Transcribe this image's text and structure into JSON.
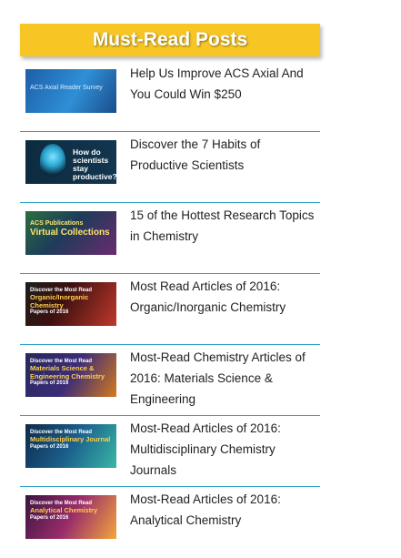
{
  "header": {
    "title": "Must-Read Posts"
  },
  "thumbnails": [
    {
      "l1": "ACS Axial Reader Survey",
      "l2": "",
      "l3": ""
    },
    {
      "l1": "How do scientists stay productive?",
      "l2": "",
      "l3": ""
    },
    {
      "l1": "ACS Publications",
      "l2": "Virtual Collections",
      "l3": ""
    },
    {
      "l1": "Discover the Most Read",
      "l2": "Organic/Inorganic Chemistry",
      "l3": "Papers of 2016"
    },
    {
      "l1": "Discover the Most Read",
      "l2": "Materials Science & Engineering Chemistry",
      "l3": "Papers of 2016"
    },
    {
      "l1": "Discover the Most Read",
      "l2": "Multidisciplinary Journal",
      "l3": "Papers of 2016"
    },
    {
      "l1": "Discover the Most Read",
      "l2": "Analytical Chemistry",
      "l3": "Papers of 2016"
    }
  ],
  "posts": [
    {
      "title": "Help Us Improve ACS Axial And You Could Win $250"
    },
    {
      "title": "Discover the 7 Habits of Productive Scientists"
    },
    {
      "title": "15 of the Hottest Research Topics in Chemistry"
    },
    {
      "title": "Most Read Articles of 2016: Organic/Inorganic Chemistry"
    },
    {
      "title": "Most-Read Chemistry Articles of 2016: Materials Science & Engineering"
    },
    {
      "title": "Most-Read Articles of 2016: Multidisciplinary Chemistry Journals"
    },
    {
      "title": "Most-Read Articles of 2016: Analytical Chemistry"
    }
  ]
}
